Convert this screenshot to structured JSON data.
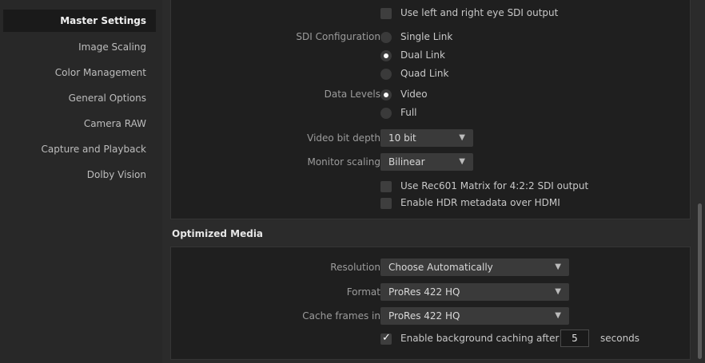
{
  "sidebar": {
    "items": [
      {
        "label": "Master Settings"
      },
      {
        "label": "Image Scaling"
      },
      {
        "label": "Color Management"
      },
      {
        "label": "General Options"
      },
      {
        "label": "Camera RAW"
      },
      {
        "label": "Capture and Playback"
      },
      {
        "label": "Dolby Vision"
      }
    ]
  },
  "video_monitoring": {
    "eye_sdi_label": "Use left and right eye SDI output",
    "eye_sdi_checked": false,
    "sdi_config_label": "SDI Configuration",
    "sdi_options": [
      "Single Link",
      "Dual Link",
      "Quad Link"
    ],
    "sdi_selected": "Dual Link",
    "data_levels_label": "Data Levels",
    "data_levels_options": [
      "Video",
      "Full"
    ],
    "data_levels_selected": "Video",
    "bit_depth_label": "Video bit depth",
    "bit_depth_value": "10 bit",
    "monitor_scaling_label": "Monitor scaling",
    "monitor_scaling_value": "Bilinear",
    "rec601_label": "Use Rec601 Matrix for 4:2:2 SDI output",
    "rec601_checked": false,
    "hdr_label": "Enable HDR metadata over HDMI",
    "hdr_checked": false
  },
  "optimized_media": {
    "title": "Optimized Media",
    "resolution_label": "Resolution",
    "resolution_value": "Choose Automatically",
    "format_label": "Format",
    "format_value": "ProRes 422 HQ",
    "cache_label": "Cache frames in",
    "cache_value": "ProRes 422 HQ",
    "bg_cache_label": "Enable background caching after",
    "bg_cache_checked": true,
    "bg_cache_seconds": "5",
    "seconds_label": "seconds"
  },
  "icons": {
    "chevron": "chevron-down-icon",
    "check": "checkmark-icon"
  },
  "colors": {
    "background": "#2b2b2b",
    "panel": "#1f1f1f",
    "sidebar_active": "#1a1a1a",
    "control": "#3a3a3a"
  }
}
